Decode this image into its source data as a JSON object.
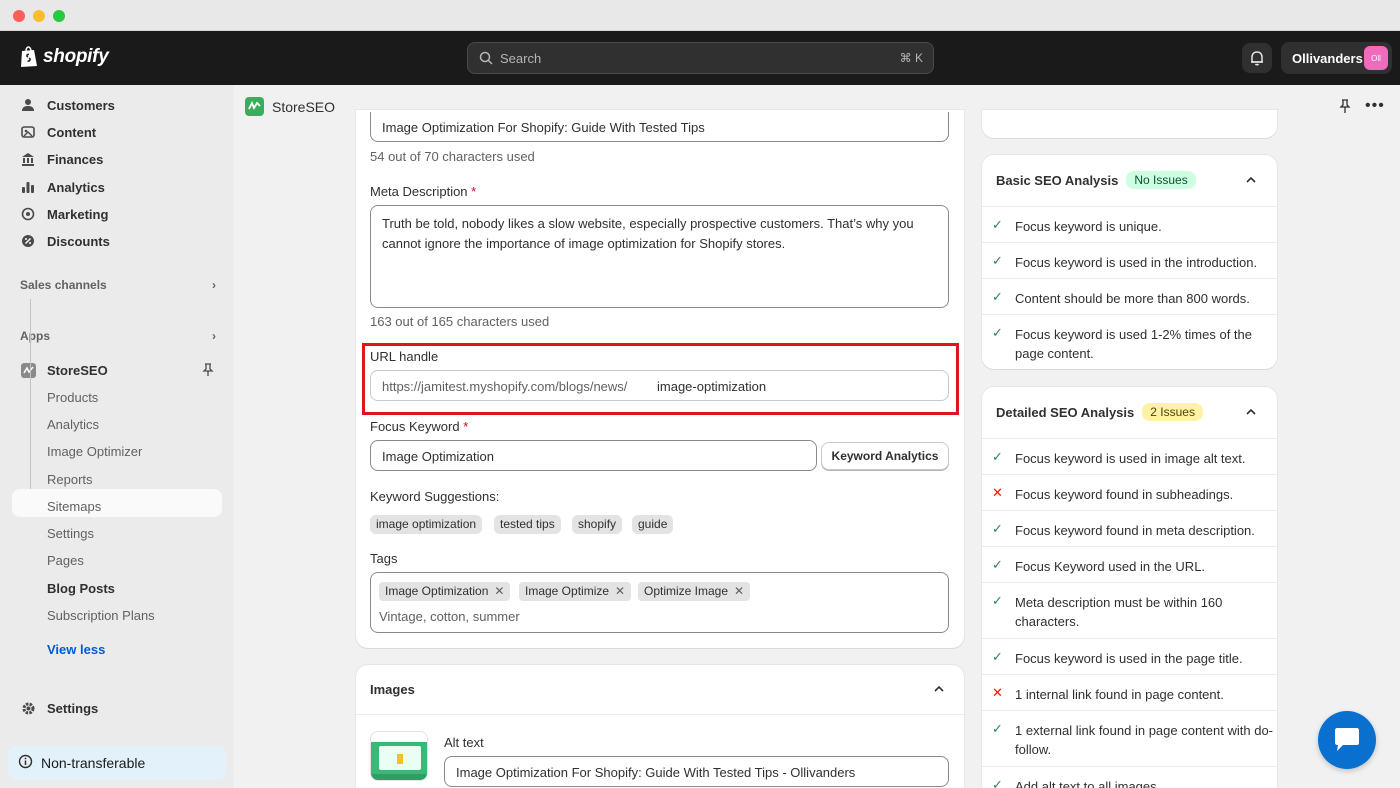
{
  "topbar": {
    "brand": "shopify",
    "search_placeholder": "Search",
    "search_shortcut": "⌘ K",
    "store_name": "Ollivanders",
    "store_initials": "Oll"
  },
  "sidebar": {
    "items": [
      {
        "label": "Customers",
        "icon": "person-icon"
      },
      {
        "label": "Content",
        "icon": "content-icon"
      },
      {
        "label": "Finances",
        "icon": "bank-icon"
      },
      {
        "label": "Analytics",
        "icon": "bar-chart-icon"
      },
      {
        "label": "Marketing",
        "icon": "target-icon"
      },
      {
        "label": "Discounts",
        "icon": "discount-icon"
      }
    ],
    "sales_channels": "Sales channels",
    "apps": "Apps",
    "app_name": "StoreSEO",
    "sub_items": [
      "Products",
      "Analytics",
      "Image Optimizer",
      "Reports",
      "Sitemaps",
      "Settings",
      "Pages",
      "Blog Posts",
      "Subscription Plans"
    ],
    "view_less": "View less",
    "settings": "Settings",
    "non_transferable": "Non-transferable"
  },
  "app_header": {
    "title": "StoreSEO"
  },
  "form": {
    "title_value": "Image Optimization For Shopify: Guide With Tested Tips",
    "title_count": "54 out of 70 characters used",
    "meta_label": "Meta Description",
    "meta_value": "Truth be told, nobody likes a slow website, especially prospective customers. That’s why you cannot ignore the importance of image optimization for Shopify stores.",
    "meta_count": "163 out of 165 characters used",
    "url_label": "URL handle",
    "url_prefix": "https://jamitest.myshopify.com/blogs/news/",
    "url_value": "image-optimization",
    "focus_label": "Focus Keyword",
    "focus_value": "Image Optimization",
    "keyword_button": "Keyword Analytics",
    "suggestions_label": "Keyword Suggestions:",
    "suggestions": [
      "image optimization",
      "tested tips",
      "shopify",
      "guide"
    ],
    "tags_label": "Tags",
    "tags": [
      "Image Optimization",
      "Image Optimize",
      "Optimize Image"
    ],
    "tags_placeholder": "Vintage, cotton, summer",
    "required_mark": "*"
  },
  "images": {
    "title": "Images",
    "alt_label": "Alt text",
    "alt_value": "Image Optimization For Shopify: Guide With Tested Tips - Ollivanders"
  },
  "basic_seo": {
    "title": "Basic SEO Analysis",
    "badge": "No Issues",
    "checks": [
      {
        "text": "Focus keyword is unique.",
        "status": "pass"
      },
      {
        "text": "Focus keyword is used in the introduction.",
        "status": "pass"
      },
      {
        "text": "Content should be more than 800 words.",
        "status": "pass"
      },
      {
        "text": "Focus keyword is used 1-2% times of the page content.",
        "status": "pass"
      }
    ]
  },
  "detailed_seo": {
    "title": "Detailed SEO Analysis",
    "badge": "2 Issues",
    "checks": [
      {
        "text": "Focus keyword is used in image alt text.",
        "status": "pass"
      },
      {
        "text": "Focus keyword found in subheadings.",
        "status": "fail"
      },
      {
        "text": "Focus keyword found in meta description.",
        "status": "pass"
      },
      {
        "text": "Focus Keyword used in the URL.",
        "status": "pass"
      },
      {
        "text": "Meta description must be within 160 characters.",
        "status": "pass"
      },
      {
        "text": "Focus keyword is used in the page title.",
        "status": "pass"
      },
      {
        "text": "1 internal link found in page content.",
        "status": "fail"
      },
      {
        "text": "1 external link found in page content with do-follow.",
        "status": "pass"
      },
      {
        "text": "Add alt text to all images.",
        "status": "pass"
      }
    ]
  },
  "glyphs": {
    "check": "✓",
    "cross": "✕",
    "remove": "✕",
    "more": "•••"
  },
  "colors": {
    "accent": "#005bd3",
    "pass": "#29845a",
    "fail": "#e51c00",
    "highlight": "#e0141e"
  }
}
